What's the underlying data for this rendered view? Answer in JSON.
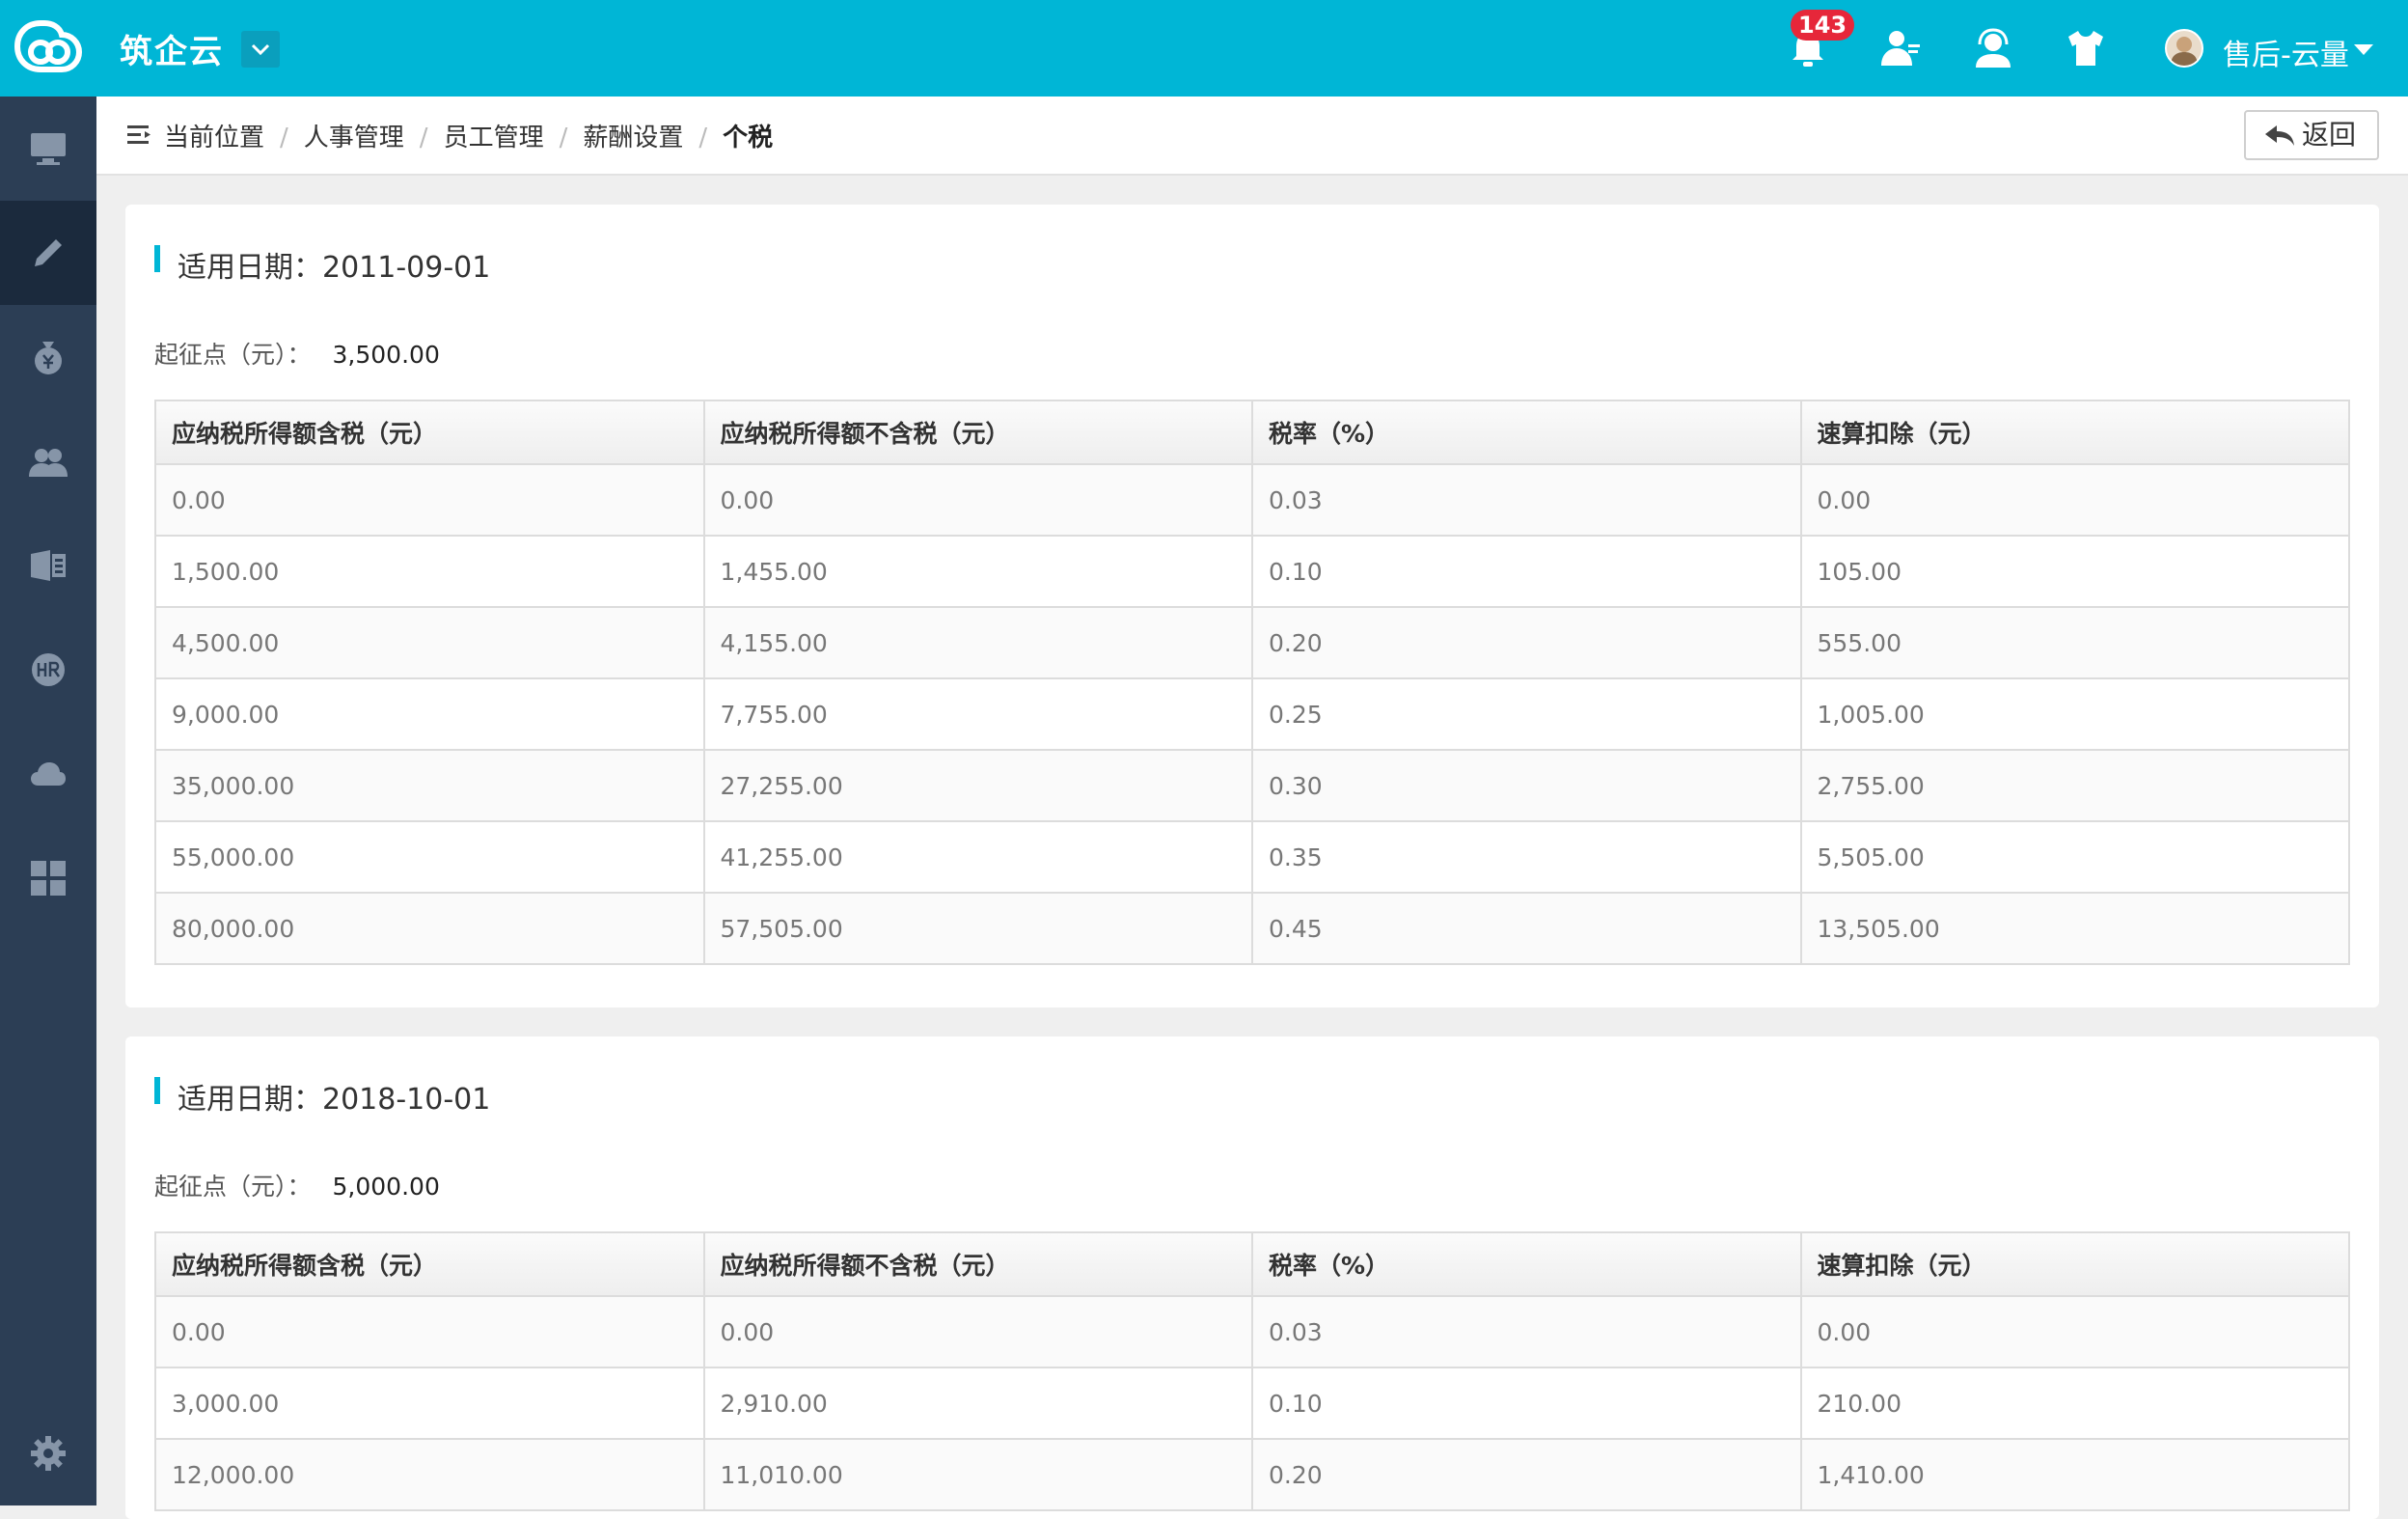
{
  "header": {
    "brand": "筑企云",
    "notification_count": "143",
    "username": "售后-云量"
  },
  "breadcrumb": {
    "label": "当前位置",
    "items": [
      "人事管理",
      "员工管理",
      "薪酬设置",
      "个税"
    ]
  },
  "back_button": {
    "label": "返回"
  },
  "icons": {
    "sidebar": [
      "monitor-icon",
      "pencil-icon",
      "money-bag-icon",
      "users-icon",
      "office-icon",
      "hr-icon",
      "cloud-icon",
      "grid-icon",
      "settings-icon"
    ],
    "header": [
      "bell-icon",
      "user-card-icon",
      "support-icon",
      "shirt-icon"
    ]
  },
  "colors": {
    "accent": "#00b6d6",
    "sidebar": "#2c3e55",
    "badge": "#e6273a"
  },
  "columns": [
    "应纳税所得额含税（元）",
    "应纳税所得额不含税（元）",
    "税率（%）",
    "速算扣除（元）"
  ],
  "panels": [
    {
      "title": "适用日期：2011-09-01",
      "threshold_label": "起征点（元）：",
      "threshold_value": "3,500.00",
      "rows": [
        [
          "0.00",
          "0.00",
          "0.03",
          "0.00"
        ],
        [
          "1,500.00",
          "1,455.00",
          "0.10",
          "105.00"
        ],
        [
          "4,500.00",
          "4,155.00",
          "0.20",
          "555.00"
        ],
        [
          "9,000.00",
          "7,755.00",
          "0.25",
          "1,005.00"
        ],
        [
          "35,000.00",
          "27,255.00",
          "0.30",
          "2,755.00"
        ],
        [
          "55,000.00",
          "41,255.00",
          "0.35",
          "5,505.00"
        ],
        [
          "80,000.00",
          "57,505.00",
          "0.45",
          "13,505.00"
        ]
      ]
    },
    {
      "title": "适用日期：2018-10-01",
      "threshold_label": "起征点（元）：",
      "threshold_value": "5,000.00",
      "rows": [
        [
          "0.00",
          "0.00",
          "0.03",
          "0.00"
        ],
        [
          "3,000.00",
          "2,910.00",
          "0.10",
          "210.00"
        ],
        [
          "12,000.00",
          "11,010.00",
          "0.20",
          "1,410.00"
        ]
      ]
    }
  ]
}
